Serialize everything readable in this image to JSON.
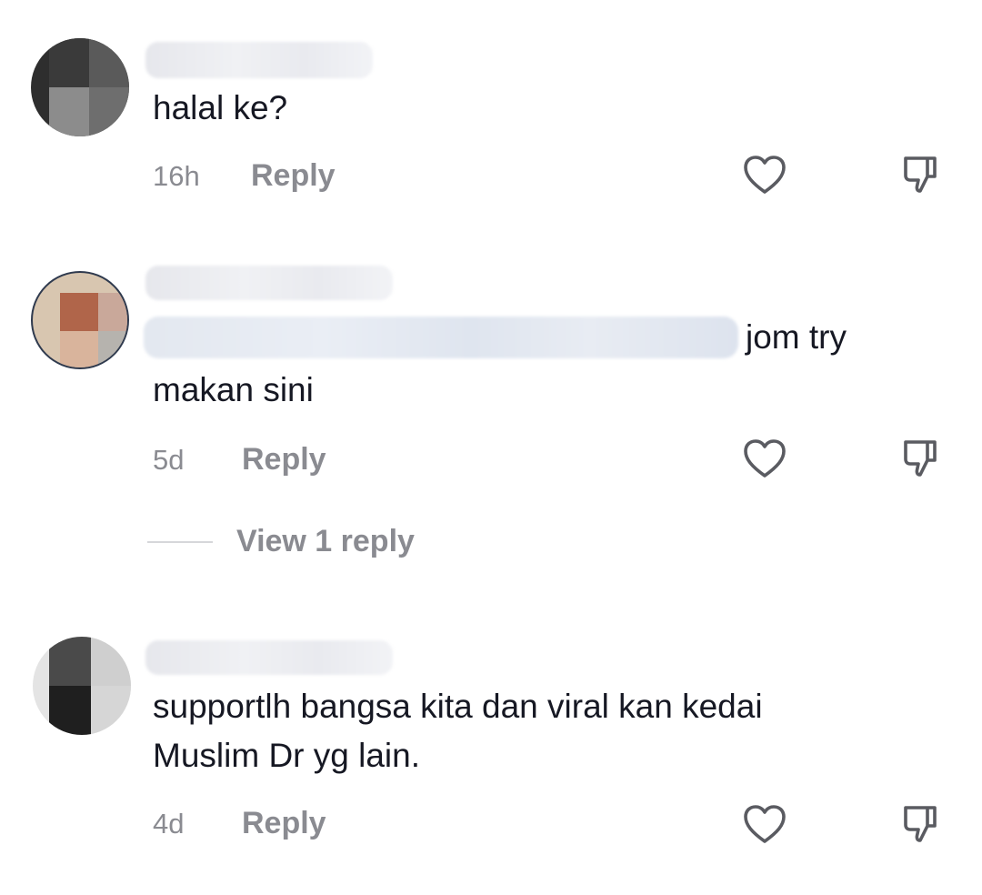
{
  "comments": [
    {
      "text": "halal ke?",
      "time": "16h",
      "reply_label": "Reply"
    },
    {
      "text_line1": "jom try",
      "text_line2": "makan sini",
      "time": "5d",
      "reply_label": "Reply",
      "view_replies_label": "View 1 reply"
    },
    {
      "text_line1": "supportlh bangsa kita dan viral kan kedai",
      "text_line2": "Muslim Dr yg lain.",
      "time": "4d",
      "reply_label": "Reply"
    }
  ],
  "icons": {
    "like": "heart-outline-icon",
    "dislike": "thumbs-down-outline-icon"
  },
  "colors": {
    "text": "#161823",
    "muted": "#8a8b91",
    "icon": "#5a5b61"
  }
}
